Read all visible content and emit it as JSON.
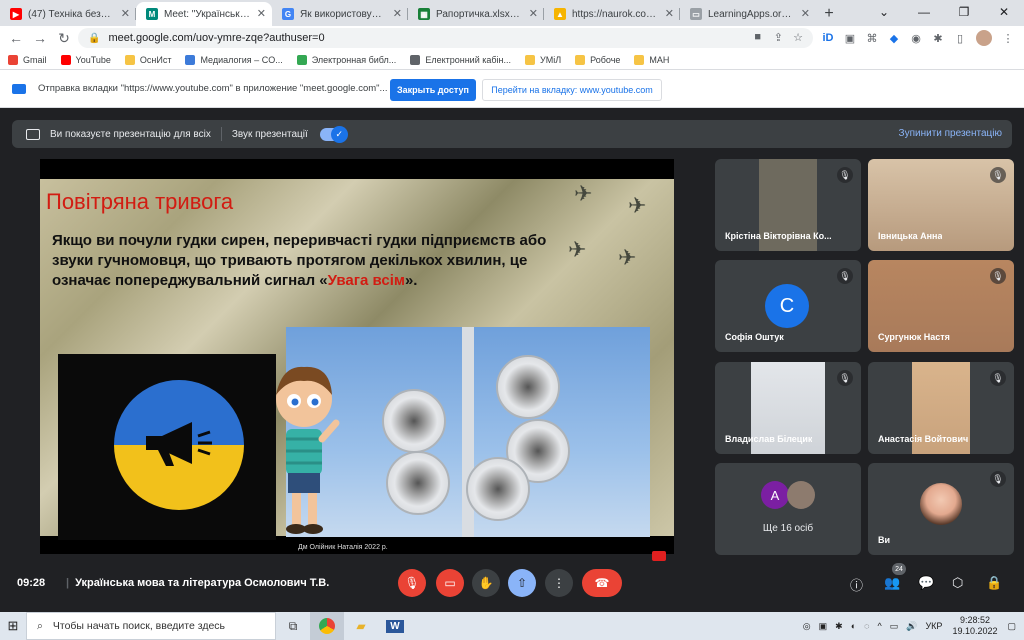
{
  "tabs": [
    {
      "title": "(47) Техніка безпеки",
      "color": "#ff0000",
      "glyph": "▶"
    },
    {
      "title": "Meet: \"Українська м",
      "color": "#00897b",
      "glyph": "M",
      "active": true
    },
    {
      "title": "Як використовувати сер",
      "color": "#4285f4",
      "glyph": "G"
    },
    {
      "title": "Рапортичка.xlsx - Googl",
      "color": "#188038",
      "glyph": "▦"
    },
    {
      "title": "https://naurok.com.ua/te",
      "color": "#f6b400",
      "glyph": "▲"
    },
    {
      "title": "LearningApps.org - інте",
      "color": "#9aa0a6",
      "glyph": "▭"
    }
  ],
  "url": "meet.google.com/uov-ymre-zqe?authuser=0",
  "bookmarks": [
    {
      "label": "Gmail",
      "color": "#ea4335"
    },
    {
      "label": "YouTube",
      "color": "#ff0000"
    },
    {
      "label": "ОснИст",
      "color": "#f6c445"
    },
    {
      "label": "Медиалогия – CO...",
      "color": "#3d7bd9"
    },
    {
      "label": "Электронная библ...",
      "color": "#34a853"
    },
    {
      "label": "Електронний кабін...",
      "color": "#5f6368"
    },
    {
      "label": "УМіЛ",
      "color": "#f6c445"
    },
    {
      "label": "Робоче",
      "color": "#f6c445"
    },
    {
      "label": "МАН",
      "color": "#f6c445"
    }
  ],
  "infobar": {
    "message": "Отправка вкладки \"https://www.youtube.com\" в приложение \"meet.google.com\"...",
    "close_access": "Закрыть доступ",
    "switch_tab": "Перейти на вкладку: www.youtube.com"
  },
  "presbar": {
    "presenting": "Ви показуєте презентацію для всіх",
    "sound": "Звук презентації",
    "stop": "Зупинити презентацію"
  },
  "slide": {
    "title": "Повітряна тривога",
    "text_before": "Якщо ви почули гудки сирен, переривчасті гудки підприємств або звуки гучномовця, що тривають протягом декількох хвилин, це означає попереджувальний сигнал «",
    "text_red": "Увага всім",
    "text_after": "».",
    "credit": "Дм Олійник Наталія 2022 р."
  },
  "participants": [
    {
      "name": "Крістіна Вікторівна Ко...",
      "bg": "#6e6a5e"
    },
    {
      "name": "Івницька Анна",
      "bg": "#b79a7d"
    },
    {
      "name": "Софія Оштук",
      "initial": "С"
    },
    {
      "name": "Сургунюк Настя",
      "bg": "#a87a5a"
    },
    {
      "name": "Владислав Білецик",
      "bg": "#cfd3d8"
    },
    {
      "name": "Анастасія Войтович",
      "bg": "#c8a27c"
    }
  ],
  "more": {
    "label": "Ще 16 осіб",
    "initial": "A"
  },
  "self": {
    "name": "Ви"
  },
  "bottom": {
    "time": "09:28",
    "meeting": "Українська мова та література Осмолович Т.В.",
    "people_count": "24"
  },
  "taskbar": {
    "search": "Чтобы начать поиск, введите здесь",
    "lang": "УКР",
    "time": "9:28:52",
    "date": "19.10.2022"
  }
}
